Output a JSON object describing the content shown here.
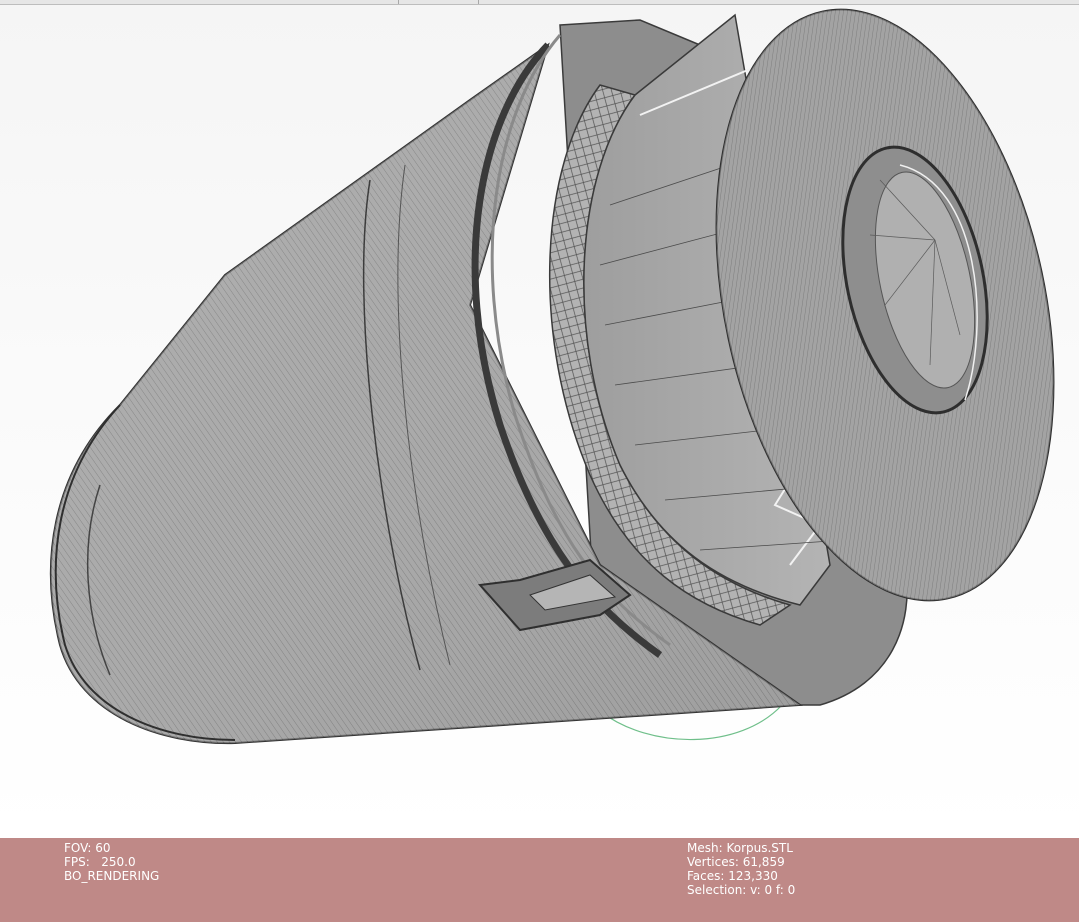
{
  "viewport": {
    "background_top": "#f5f5f5",
    "background_bottom": "#ffffff",
    "mesh_fill": "#a9a9a9",
    "wire_color": "#3b3b3b",
    "trackball_color": "#6fbf8a"
  },
  "info_panel": {
    "background": "#bf8987",
    "text_color": "#ffffff",
    "left": {
      "fov": "FOV: 60",
      "fps": "FPS:   250.0",
      "mode": "BO_RENDERING"
    },
    "right": {
      "mesh": "Mesh: Korpus.STL",
      "vertices": "Vertices: 61,859",
      "faces": "Faces: 123,330",
      "selection": "Selection: v: 0 f: 0"
    }
  }
}
